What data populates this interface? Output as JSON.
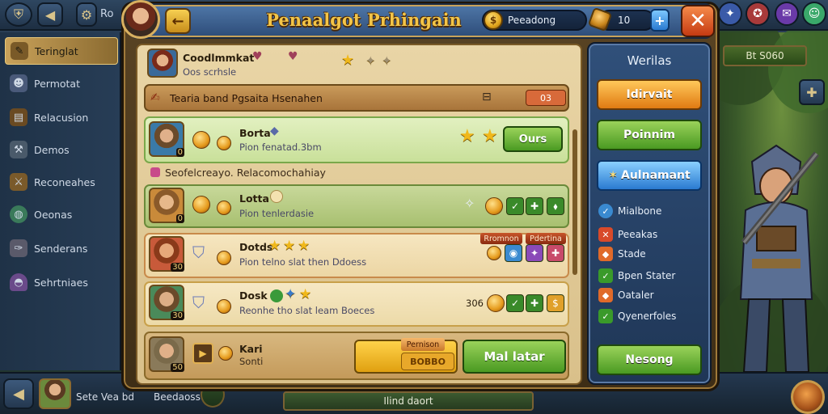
{
  "topbar": {
    "left_label": "Ro",
    "right_badge": "Bt S060"
  },
  "sidebar": {
    "items": [
      {
        "label": "Teringlat",
        "icon": "quest-icon"
      },
      {
        "label": "Permotat",
        "icon": "people-icon"
      },
      {
        "label": "Relacusion",
        "icon": "book-icon"
      },
      {
        "label": "Demos",
        "icon": "tools-icon"
      },
      {
        "label": "Reconeahes",
        "icon": "hammer-icon"
      },
      {
        "label": "Oeonas",
        "icon": "globe-icon"
      },
      {
        "label": "Senderans",
        "icon": "scroll-icon"
      },
      {
        "label": "Sehrtniaes",
        "icon": "helmet-icon"
      }
    ]
  },
  "header": {
    "title": "Penaalgot Prhingain",
    "resource_label": "Peeadong",
    "resource2_value": "10",
    "plus_label": "+",
    "close_label": "✕",
    "back_label": "←"
  },
  "profile": {
    "name": "Coodlmmkat",
    "sub": "Oos scrhsle"
  },
  "banner": {
    "text": "Tearia band Pgsaita Hsenahen",
    "value": "03"
  },
  "note": {
    "text": "Seofelcreayo. Relacomochahiay"
  },
  "rows": [
    {
      "name": "Borta",
      "desc": "Pion fenatad.3bm",
      "level": "0",
      "button": "Ours"
    },
    {
      "name": "Lotta",
      "desc": "Pion tenlerdasie",
      "level": "0"
    },
    {
      "name": "Dotds",
      "desc": "Pion telno slat then Ddoess",
      "level": "30",
      "tags": [
        "Rromnon",
        "Pdertina"
      ]
    },
    {
      "name": "Dosk",
      "desc": "Reonhe tho slat leam Boeces",
      "level": "30",
      "value": "306"
    },
    {
      "name": "Kari",
      "desc": "Sonti",
      "level": "50",
      "tag": "Pernison",
      "bar_label": "BOBBO",
      "button": "Mal latar"
    }
  ],
  "rightpanel": {
    "title": "Werilas",
    "btn1": "Idirvait",
    "btn2": "Poinnim",
    "btn3": "Aulnamant",
    "items": [
      "Mialbone",
      "Peeakas",
      "Stade",
      "Bpen Stater",
      "Oataler",
      "Qyenerfoles"
    ],
    "btn4": "Nesong"
  },
  "bottombar": {
    "text1": "Sete Vea bd",
    "text2": "Beedaoss",
    "center": "Ilind daort"
  },
  "colors": {
    "header_gold": "#f3c548",
    "green_button": "#4a9a22",
    "orange_button": "#f0a02a",
    "blue_button": "#3a8ee0",
    "close_red": "#c53a12"
  }
}
